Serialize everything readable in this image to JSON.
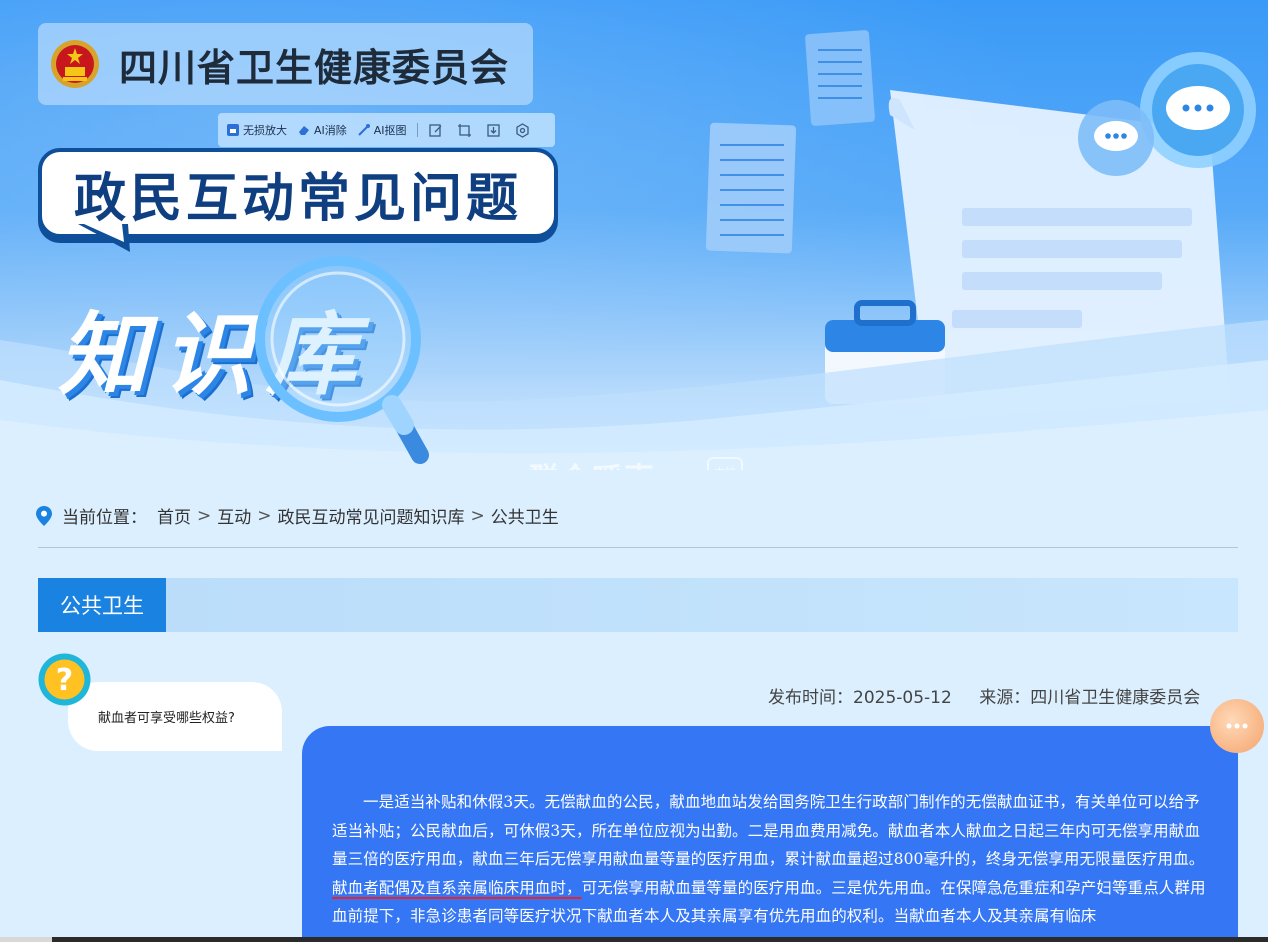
{
  "header": {
    "org_name": "四川省卫生健康委员会",
    "banner_title": "政民互动常见问题",
    "banner_subtitle": "知识库",
    "watermark": "群众呼声",
    "watermark_badge": "由地"
  },
  "toolbar": {
    "items": [
      "无损放大",
      "AI消除",
      "AI抠图"
    ],
    "icons": [
      "edit-icon",
      "crop-icon",
      "download-icon",
      "settings-icon"
    ]
  },
  "breadcrumb": {
    "label": "当前位置：",
    "items": [
      "首页",
      "互动",
      "政民互动常见问题知识库",
      "公共卫生"
    ],
    "separator": ">"
  },
  "section": {
    "tab_label": "公共卫生"
  },
  "qa": {
    "question": "献血者可享受哪些权益?",
    "publish_time": "发布时间：2025-05-12",
    "source": "来源：四川省卫生健康委员会",
    "answer_part1": "一是适当补贴和休假3天。无偿献血的公民，献血地血站发给国务院卫生行政部门制作的无偿献血证书，有关单位可以给予适当补贴；公民献血后，可休假3天，所在单位应视为出勤。二是用血费用减免。献血者本人献血之日起三年内可无偿享用献血量三倍的医疗用血，献血三年后无偿享用献血量等量的医疗用血，累计献血量超过800毫升的，终身无偿享用无限量医疗用血。",
    "answer_highlight": "献血者配偶及直系亲属临床用血时，",
    "answer_part2": "可无偿享用献血量等量的医疗用血。三是优先用血。在保障急危重症和孕产妇等重点人群用血前提下，非急诊患者同等医疗状况下献血者本人及其亲属享有优先用血的权利。当献血者本人及其亲属有临床"
  },
  "colors": {
    "accent_blue": "#1a82e0",
    "answer_bg": "#3576f5",
    "highlight_underline": "#e5242b",
    "banner_dark": "#0f3f80"
  }
}
